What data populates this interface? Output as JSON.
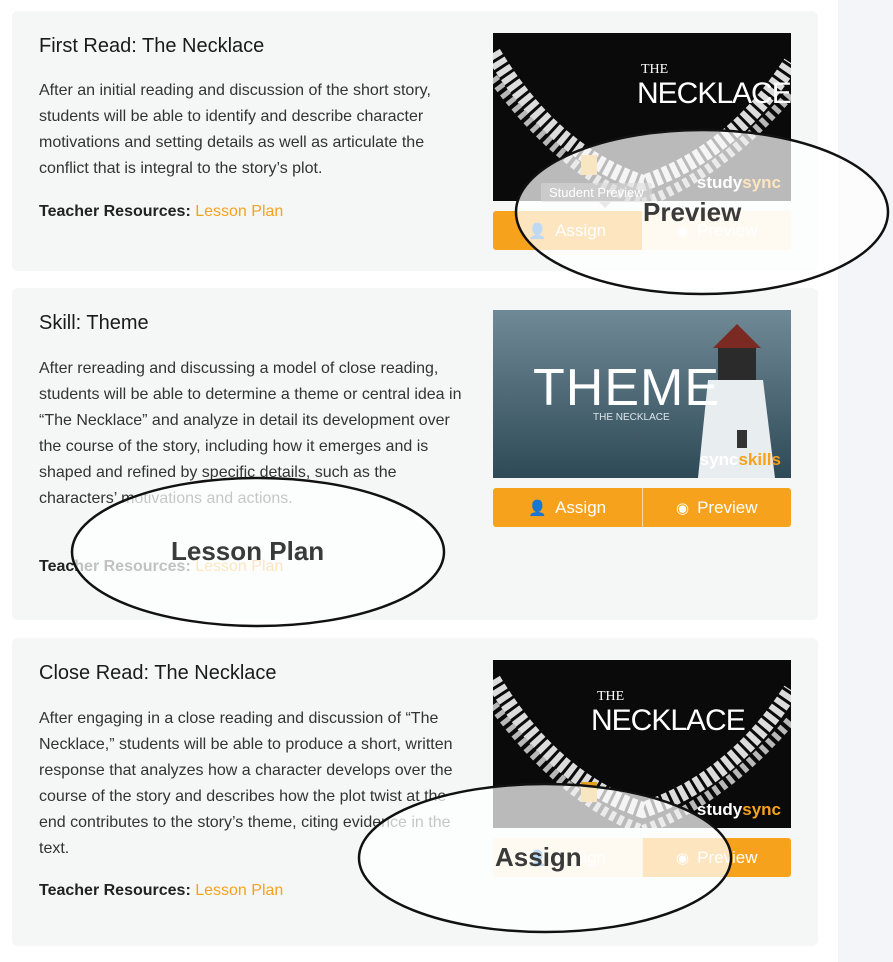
{
  "cards": [
    {
      "title": "First Read: The Necklace",
      "description": "After an initial reading and discussion of the short story, students will be able to identify and describe character motivations and setting details as well as articulate the conflict that is integral to the story’s plot.",
      "resources_label": "Teacher Resources:",
      "resources_link": "Lesson Plan",
      "thumb": {
        "line1": "THE",
        "line2": "NECKLACE",
        "brand_left": "study",
        "brand_right": "sync"
      },
      "assign_label": "Assign",
      "preview_label": "Preview",
      "tooltip": "Student Preview"
    },
    {
      "title": "Skill: Theme",
      "description": "After rereading and discussing a model of close reading, students will be able to determine a theme or central idea in “The Necklace” and analyze in detail its development over the course of the story, including how it emerges and is shaped and refined by specific details, such as the characters’ motivations and actions.",
      "resources_label": "Teacher Resources:",
      "resources_link": "Lesson Plan",
      "thumb": {
        "line1": "THEME",
        "line2": "THE NECKLACE",
        "brand_left": "sync",
        "brand_right": "skills"
      },
      "assign_label": "Assign",
      "preview_label": "Preview"
    },
    {
      "title": "Close Read: The Necklace",
      "description": "After engaging in a close reading and discussion of “The Necklace,” students will be able to produce a short, written response that analyzes how a character develops over the course of the story and describes how the plot twist at the end contributes to the story’s theme, citing evidence in the text.",
      "resources_label": "Teacher Resources:",
      "resources_link": "Lesson Plan",
      "thumb": {
        "line1": "THE",
        "line2": "NECKLACE",
        "brand_left": "study",
        "brand_right": "sync"
      },
      "assign_label": "Assign",
      "preview_label": "Preview"
    }
  ],
  "callouts": {
    "preview": "Preview",
    "lesson_plan": "Lesson Plan",
    "assign": "Assign"
  },
  "colors": {
    "accent": "#f7a21c",
    "card_bg": "#f5f6f6"
  }
}
